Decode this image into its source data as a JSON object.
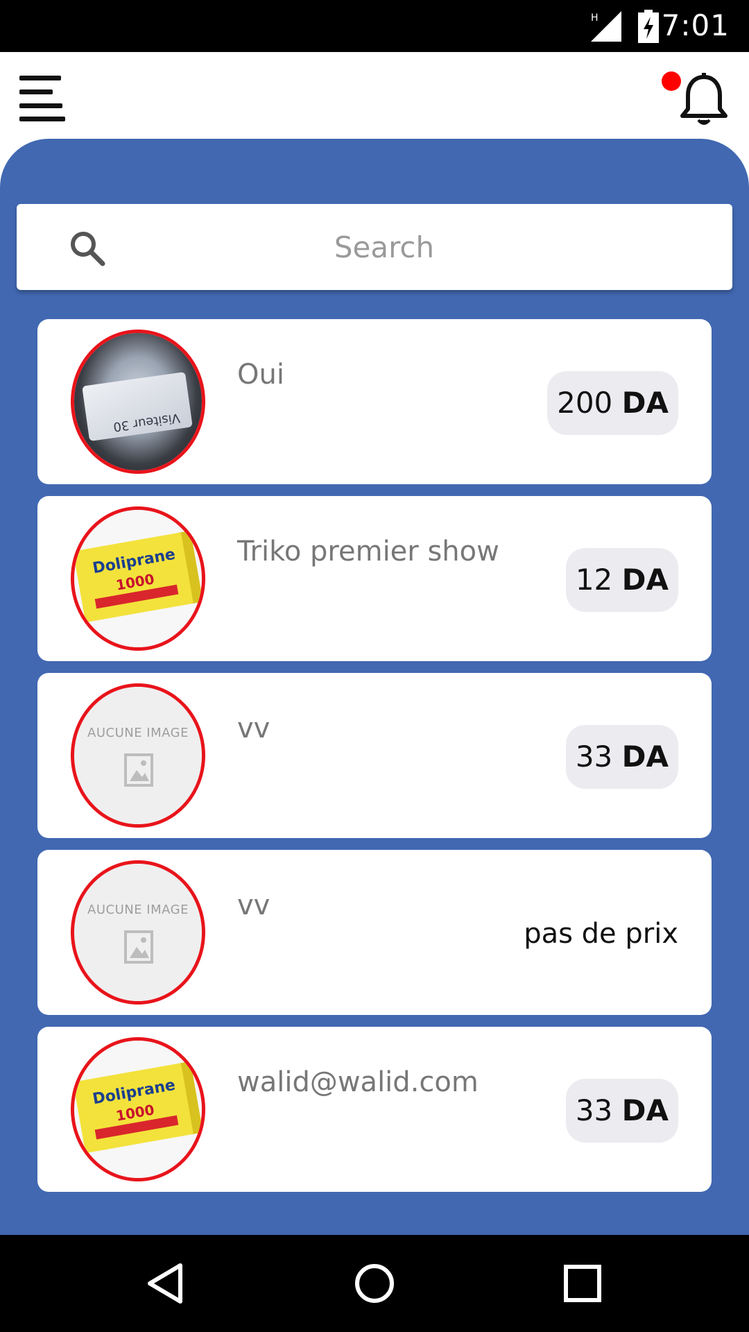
{
  "status_bar": {
    "network_label": "H",
    "time": "7:01"
  },
  "app_bar": {
    "menu_icon": "menu-icon",
    "notification_icon": "bell-icon",
    "has_unread_notifications": true
  },
  "search": {
    "placeholder": "Search",
    "value": ""
  },
  "items": [
    {
      "title": "Oui",
      "price": "200",
      "currency": "DA",
      "image": "photo",
      "image_caption": "Visiteur 30",
      "no_price_label": ""
    },
    {
      "title": "Triko premier show",
      "price": "12",
      "currency": "DA",
      "image": "doliprane",
      "image_caption": "Doliprane",
      "image_caption2": "1000",
      "no_price_label": ""
    },
    {
      "title": "vv",
      "price": "33",
      "currency": "DA",
      "image": "none",
      "image_caption": "AUCUNE IMAGE",
      "no_price_label": ""
    },
    {
      "title": "vv",
      "price": "",
      "currency": "",
      "image": "none",
      "image_caption": "AUCUNE IMAGE",
      "no_price_label": "pas de prix"
    },
    {
      "title": "walid@walid.com",
      "price": "33",
      "currency": "DA",
      "image": "doliprane",
      "image_caption": "Doliprane",
      "image_caption2": "1000",
      "no_price_label": ""
    }
  ],
  "colors": {
    "panel_blue": "#4168b1",
    "thumb_border": "#e8141b",
    "notif_dot": "#ff0000",
    "price_pill_bg": "#ebebf0"
  },
  "nav_bar": {
    "back_icon": "back-triangle-icon",
    "home_icon": "home-circle-icon",
    "recents_icon": "recents-square-icon"
  }
}
